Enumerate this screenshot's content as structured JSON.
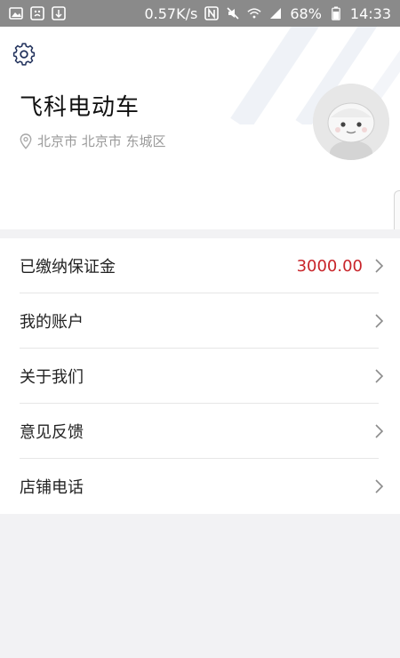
{
  "status_bar": {
    "network_speed": "0.57K/s",
    "battery": "68%",
    "time": "14:33"
  },
  "profile": {
    "name": "飞科电动车",
    "location": "北京市 北京市 东城区"
  },
  "menu": [
    {
      "label": "已缴纳保证金",
      "value": "3000.00"
    },
    {
      "label": "我的账户",
      "value": ""
    },
    {
      "label": "关于我们",
      "value": ""
    },
    {
      "label": "意见反馈",
      "value": ""
    },
    {
      "label": "店铺电话",
      "value": ""
    }
  ],
  "colors": {
    "accent_value": "#c8242a",
    "status_bar_bg": "#8a8a8a"
  },
  "icons": [
    "settings-gear-icon",
    "location-pin-icon",
    "chevron-right-icon",
    "avatar-icon"
  ]
}
